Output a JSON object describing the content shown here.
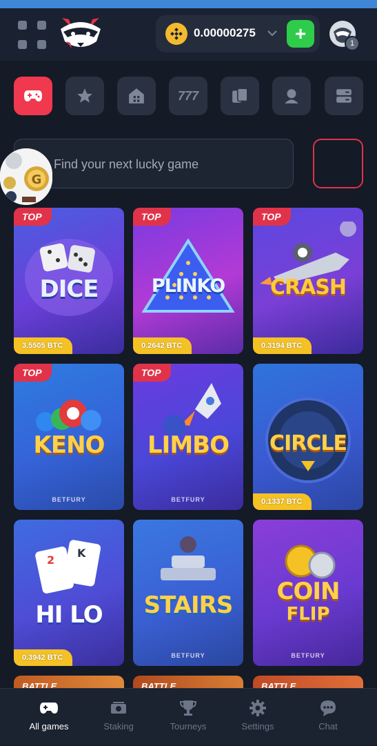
{
  "header": {
    "balance": "0.00000275",
    "add_label": "+",
    "notification_count": "1"
  },
  "categories": [
    {
      "icon": "gamepad-icon",
      "active": true
    },
    {
      "icon": "star-icon",
      "active": false
    },
    {
      "icon": "house-icon",
      "active": false
    },
    {
      "icon": "slots-777-icon",
      "active": false
    },
    {
      "icon": "cards-icon",
      "active": false
    },
    {
      "icon": "live-dealer-icon",
      "active": false
    },
    {
      "icon": "server-icon",
      "active": false
    }
  ],
  "search": {
    "placeholder": "Find your next lucky game"
  },
  "games": [
    {
      "title": "DICE",
      "subtitle": "",
      "tag": "TOP",
      "price": "3.5505 BTC",
      "brand": ""
    },
    {
      "title": "PLINKO",
      "subtitle": "",
      "tag": "TOP",
      "price": "0.2642 BTC",
      "brand": ""
    },
    {
      "title": "CRASH",
      "subtitle": "",
      "tag": "TOP",
      "price": "0.3194 BTC",
      "brand": ""
    },
    {
      "title": "KENO",
      "subtitle": "",
      "tag": "TOP",
      "price": "",
      "brand": "BETFURY"
    },
    {
      "title": "LIMBO",
      "subtitle": "",
      "tag": "TOP",
      "price": "",
      "brand": "BETFURY"
    },
    {
      "title": "CIRCLE",
      "subtitle": "",
      "tag": "",
      "price": "0.1337 BTC",
      "brand": ""
    },
    {
      "title": "HI LO",
      "subtitle": "",
      "tag": "",
      "price": "0.3942 BTC",
      "brand": ""
    },
    {
      "title": "STAIRS",
      "subtitle": "",
      "tag": "",
      "price": "",
      "brand": "BETFURY"
    },
    {
      "title": "COIN",
      "subtitle": "FLIP",
      "tag": "",
      "price": "",
      "brand": "BETFURY"
    }
  ],
  "battle_tags": [
    "BATTLE",
    "BATTLE",
    "BATTLE"
  ],
  "nav": [
    {
      "label": "All games",
      "icon": "gamepad-icon",
      "active": true
    },
    {
      "label": "Staking",
      "icon": "money-icon",
      "active": false
    },
    {
      "label": "Tourneys",
      "icon": "trophy-icon",
      "active": false
    },
    {
      "label": "Settings",
      "icon": "gear-icon",
      "active": false
    },
    {
      "label": "Chat",
      "icon": "chat-icon",
      "active": false
    }
  ],
  "colors": {
    "accent": "#f0384e",
    "price_badge": "#f5c225",
    "add_button": "#2ecc4a",
    "coin": "#f3ba2f"
  }
}
